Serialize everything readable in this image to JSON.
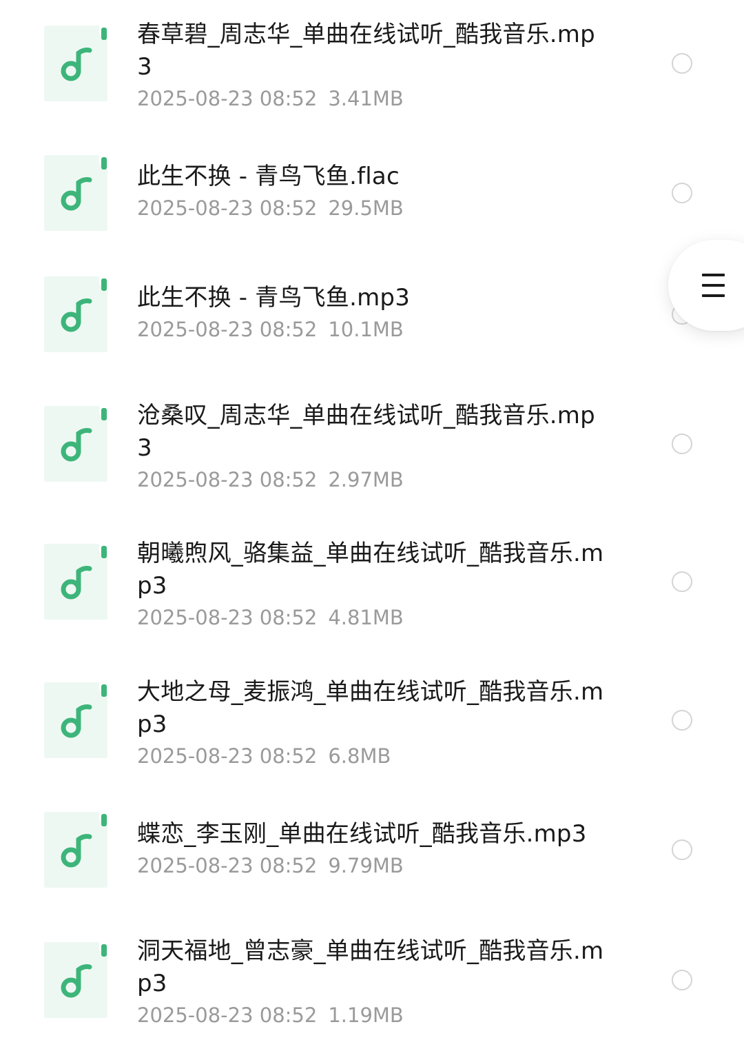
{
  "files": [
    {
      "name": "春草碧_周志华_单曲在线试听_酷我音乐.mp3",
      "date": "2025-08-23 08:52",
      "size": "3.41MB",
      "icon": "music-note-icon"
    },
    {
      "name": "此生不换 - 青鸟飞鱼.flac",
      "date": "2025-08-23 08:52",
      "size": "29.5MB",
      "icon": "music-note-icon"
    },
    {
      "name": "此生不换 - 青鸟飞鱼.mp3",
      "date": "2025-08-23 08:52",
      "size": "10.1MB",
      "icon": "music-note-icon"
    },
    {
      "name": "沧桑叹_周志华_单曲在线试听_酷我音乐.mp3",
      "date": "2025-08-23 08:52",
      "size": "2.97MB",
      "icon": "music-note-icon"
    },
    {
      "name": "朝曦煦风_骆集益_单曲在线试听_酷我音乐.mp3",
      "date": "2025-08-23 08:52",
      "size": "4.81MB",
      "icon": "music-note-icon"
    },
    {
      "name": "大地之母_麦振鸿_单曲在线试听_酷我音乐.mp3",
      "date": "2025-08-23 08:52",
      "size": "6.8MB",
      "icon": "music-note-icon"
    },
    {
      "name": "蝶恋_李玉刚_单曲在线试听_酷我音乐.mp3",
      "date": "2025-08-23 08:52",
      "size": "9.79MB",
      "icon": "music-note-icon"
    },
    {
      "name": "洞天福地_曾志豪_单曲在线试听_酷我音乐.mp3",
      "date": "2025-08-23 08:52",
      "size": "1.19MB",
      "icon": "music-note-icon"
    }
  ],
  "floating_menu": {
    "icon": "menu-icon"
  },
  "colors": {
    "accent": "#3db57a",
    "icon_bg": "#eef8f2",
    "name_text": "#1a1a1a",
    "meta_text": "#9a9a9a",
    "radio_border": "#d4d4d4"
  }
}
